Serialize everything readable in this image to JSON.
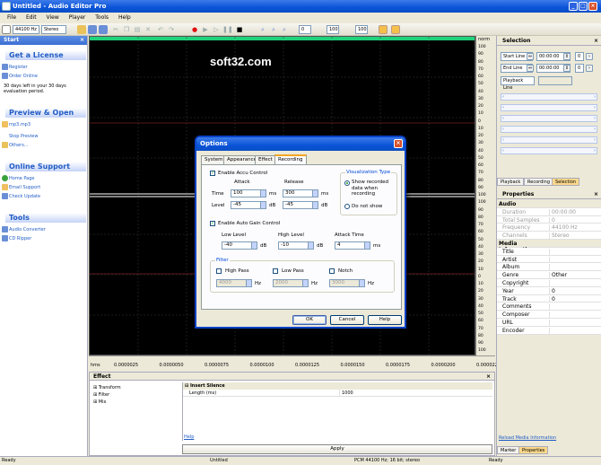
{
  "window": {
    "title": "Untitled - Audio Editor Pro"
  },
  "menu": [
    "File",
    "Edit",
    "View",
    "Player",
    "Tools",
    "Help"
  ],
  "toolbar": {
    "sample_rate": "44100 Hz",
    "channels": "Stereo",
    "zoom_fields": [
      "0",
      "100",
      "100"
    ]
  },
  "left_panel": {
    "header": "Start",
    "license": {
      "title": "Get a License",
      "register": "Register",
      "order": "Order Online",
      "note": "30 days left in your 30 days evaluation period."
    },
    "preview": {
      "title": "Preview & Open",
      "file": "mp3.mp3",
      "stop": "Stop Preview",
      "others": "Others..."
    },
    "support": {
      "title": "Online Support",
      "home": "Home Page",
      "email": "Email Support",
      "update": "Check Update"
    },
    "tools": {
      "title": "Tools",
      "converter": "Audio Converter",
      "ripper": "CD Ripper"
    }
  },
  "watermark": "soft32.com",
  "scale": {
    "header": "norm",
    "ticks": [
      "100",
      "90",
      "80",
      "70",
      "60",
      "50",
      "40",
      "30",
      "20",
      "10",
      "0",
      "10",
      "20",
      "30",
      "40",
      "50",
      "60",
      "70",
      "80",
      "90",
      "100",
      "100",
      "90",
      "80",
      "70",
      "60",
      "50",
      "40",
      "30",
      "20",
      "10",
      "0",
      "10",
      "20",
      "30",
      "40",
      "50",
      "60",
      "70",
      "80",
      "90",
      "100"
    ]
  },
  "ruler": {
    "unit": "hms",
    "labels": [
      "0.0000025",
      "0.0000050",
      "0.0000075",
      "0.0000100",
      "0.0000125",
      "0.0000150",
      "0.0000175",
      "0.0000200",
      "0.0000225"
    ]
  },
  "effect_panel": {
    "header": "Effect",
    "tree": [
      "Transform",
      "Filter",
      "Mix"
    ],
    "insert_header": "Insert Silence",
    "param_name": "Length (ms)",
    "param_value": "1000",
    "help": "Help",
    "apply": "Apply"
  },
  "selection_panel": {
    "header": "Selection",
    "start_label": "Start Line",
    "end_label": "End Line",
    "start_time": "00:00:00",
    "end_time": "00:00:00",
    "start_frame": "0",
    "end_frame": "0",
    "playback_label": "Playback Line",
    "tabs": [
      "Playback",
      "Recording",
      "Selection"
    ]
  },
  "properties_panel": {
    "header": "Properties",
    "audio_category": "Audio",
    "audio_rows": [
      {
        "key": "Duration",
        "value": "00:00:00"
      },
      {
        "key": "Total Samples",
        "value": "0"
      },
      {
        "key": "Frequency",
        "value": "44100 Hz"
      },
      {
        "key": "Channels",
        "value": "Stereo"
      }
    ],
    "media_category": "Media Information",
    "media_rows": [
      {
        "key": "Title",
        "value": ""
      },
      {
        "key": "Artist",
        "value": ""
      },
      {
        "key": "Album",
        "value": ""
      },
      {
        "key": "Genre",
        "value": "Other"
      },
      {
        "key": "Copyright",
        "value": ""
      },
      {
        "key": "Year",
        "value": "0"
      },
      {
        "key": "Track",
        "value": "0"
      },
      {
        "key": "Comments",
        "value": ""
      },
      {
        "key": "Composer",
        "value": ""
      },
      {
        "key": "URL",
        "value": ""
      },
      {
        "key": "Encoder",
        "value": ""
      }
    ],
    "reload_link": "Reload Media Information",
    "tabs": [
      "Marker",
      "Properties"
    ]
  },
  "dialog": {
    "title": "Options",
    "tabs": [
      "System",
      "Appearance",
      "Effect",
      "Recording"
    ],
    "accu": {
      "label": "Enable Accu Control",
      "attack_label": "Attack",
      "release_label": "Release",
      "time_label": "Time",
      "level_label": "Level",
      "attack_time": "100",
      "release_time": "300",
      "attack_level": "-45",
      "release_level": "-45",
      "ms": "ms",
      "db": "dB"
    },
    "viz": {
      "title": "Visualization Type",
      "show": "Show recorded data when recording",
      "donot": "Do not show"
    },
    "agc": {
      "label": "Enable Auto Gain Control",
      "low_label": "Low Level",
      "high_label": "High Level",
      "attack_label": "Attack Time",
      "low": "-40",
      "high": "-10",
      "attack": "4",
      "db": "dB",
      "ms": "ms"
    },
    "filter": {
      "title": "Filter",
      "high_pass": "High Pass",
      "low_pass": "Low Pass",
      "notch": "Notch",
      "high_pass_value": "4000",
      "low_pass_value": "2000",
      "notch_value": "3000",
      "hz": "Hz"
    },
    "buttons": {
      "ok": "OK",
      "cancel": "Cancel",
      "help": "Help"
    }
  },
  "status": {
    "left": "Ready",
    "file": "Untitled",
    "format": "PCM 44100 Hz; 16 bit; stereo",
    "right": "Ready"
  }
}
